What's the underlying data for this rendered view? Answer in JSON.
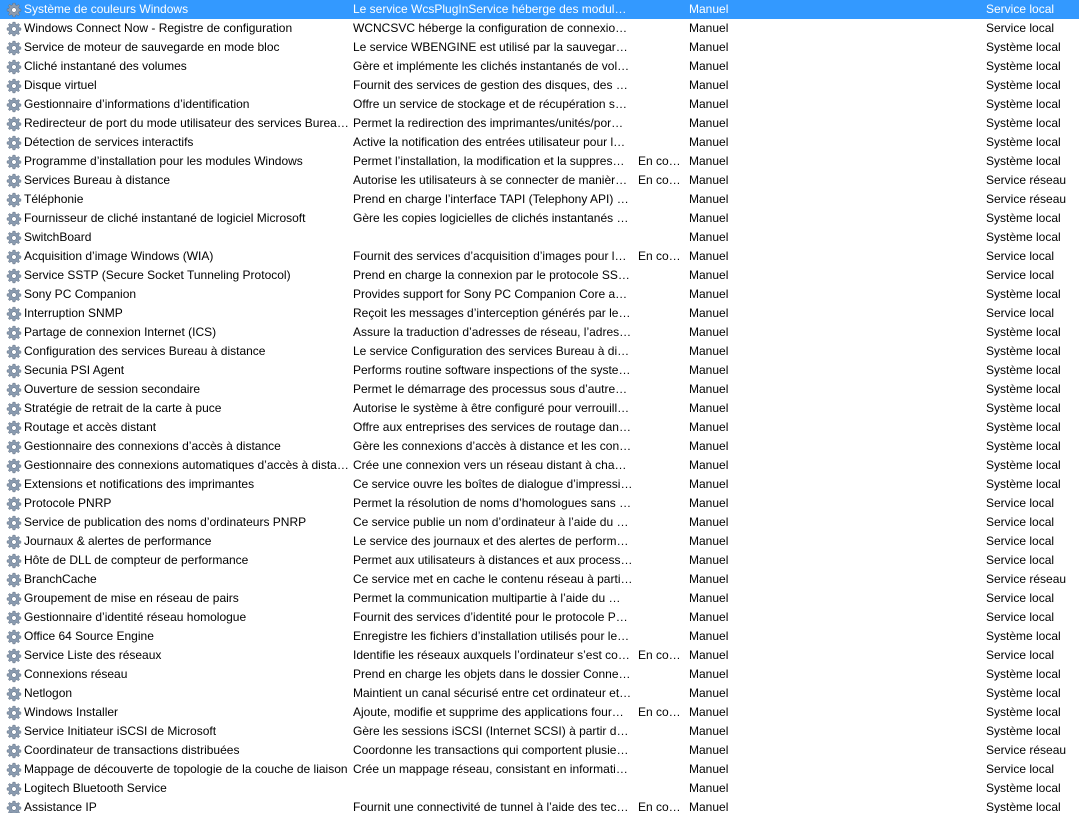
{
  "services": [
    {
      "name": "Système de couleurs Windows",
      "description": "Le service WcsPlugInService héberge des modules…",
      "status": "",
      "startup": "Manuel",
      "logon": "Service local",
      "selected": true
    },
    {
      "name": "Windows Connect Now - Registre de configuration",
      "description": "WCNCSVC héberge la configuration de connexion…",
      "status": "",
      "startup": "Manuel",
      "logon": "Service local"
    },
    {
      "name": "Service de moteur de sauvegarde en mode bloc",
      "description": "Le service WBENGINE est utilisé par la sauvegarde …",
      "status": "",
      "startup": "Manuel",
      "logon": "Système local"
    },
    {
      "name": "Cliché instantané des volumes",
      "description": "Gère et implémente les clichés instantanés de vol…",
      "status": "",
      "startup": "Manuel",
      "logon": "Système local"
    },
    {
      "name": "Disque virtuel",
      "description": "Fournit des services de gestion des disques, des v…",
      "status": "",
      "startup": "Manuel",
      "logon": "Système local"
    },
    {
      "name": "Gestionnaire d’informations d’identification",
      "description": "Offre un service de stockage et de récupération sé…",
      "status": "",
      "startup": "Manuel",
      "logon": "Système local"
    },
    {
      "name": "Redirecteur de port du mode utilisateur des services Bureau…",
      "description": "Permet la redirection des imprimantes/unités/por…",
      "status": "",
      "startup": "Manuel",
      "logon": "Système local"
    },
    {
      "name": "Détection de services interactifs",
      "description": "Active la notification des entrées utilisateur pour l…",
      "status": "",
      "startup": "Manuel",
      "logon": "Système local"
    },
    {
      "name": "Programme d’installation pour les modules Windows",
      "description": "Permet l’installation, la modification et la suppres…",
      "status": "En co…",
      "startup": "Manuel",
      "logon": "Système local"
    },
    {
      "name": "Services Bureau à distance",
      "description": "Autorise les utilisateurs à se connecter de manière…",
      "status": "En co…",
      "startup": "Manuel",
      "logon": "Service réseau"
    },
    {
      "name": "Téléphonie",
      "description": "Prend en charge l’interface TAPI (Telephony API) …",
      "status": "",
      "startup": "Manuel",
      "logon": "Service réseau"
    },
    {
      "name": "Fournisseur de cliché instantané de logiciel Microsoft",
      "description": "Gère les copies logicielles de clichés instantanés d…",
      "status": "",
      "startup": "Manuel",
      "logon": "Système local"
    },
    {
      "name": "SwitchBoard",
      "description": "",
      "status": "",
      "startup": "Manuel",
      "logon": "Système local"
    },
    {
      "name": "Acquisition d’image Windows (WIA)",
      "description": "Fournit des services d’acquisition d’images pour l…",
      "status": "En co…",
      "startup": "Manuel",
      "logon": "Service local"
    },
    {
      "name": "Service SSTP (Secure Socket Tunneling Protocol)",
      "description": "Prend en charge la connexion par le protocole SST…",
      "status": "",
      "startup": "Manuel",
      "logon": "Service local"
    },
    {
      "name": "Sony PC Companion",
      "description": "Provides support for Sony PC Companion Core an…",
      "status": "",
      "startup": "Manuel",
      "logon": "Système local"
    },
    {
      "name": "Interruption SNMP",
      "description": "Reçoit les messages d’interception générés par les…",
      "status": "",
      "startup": "Manuel",
      "logon": "Service local"
    },
    {
      "name": "Partage de connexion Internet (ICS)",
      "description": "Assure la traduction d’adresses de réseau, l’adress…",
      "status": "",
      "startup": "Manuel",
      "logon": "Système local"
    },
    {
      "name": "Configuration des services Bureau à distance",
      "description": "Le service Configuration des services Bureau à dist…",
      "status": "",
      "startup": "Manuel",
      "logon": "Système local"
    },
    {
      "name": "Secunia PSI Agent",
      "description": "Performs routine software inspections of the syste…",
      "status": "",
      "startup": "Manuel",
      "logon": "Système local"
    },
    {
      "name": "Ouverture de session secondaire",
      "description": "Permet le démarrage des processus sous d’autres i…",
      "status": "",
      "startup": "Manuel",
      "logon": "Système local"
    },
    {
      "name": "Stratégie de retrait de la carte à puce",
      "description": "Autorise le système à être configuré pour verrouill…",
      "status": "",
      "startup": "Manuel",
      "logon": "Système local"
    },
    {
      "name": "Routage et accès distant",
      "description": "Offre aux entreprises des services de routage dans …",
      "status": "",
      "startup": "Manuel",
      "logon": "Système local"
    },
    {
      "name": "Gestionnaire des connexions d’accès à distance",
      "description": "Gère les connexions d’accès à distance et les conn…",
      "status": "",
      "startup": "Manuel",
      "logon": "Système local"
    },
    {
      "name": "Gestionnaire des connexions automatiques d’accès à distan…",
      "description": "Crée une connexion vers un réseau distant à chaq…",
      "status": "",
      "startup": "Manuel",
      "logon": "Système local"
    },
    {
      "name": "Extensions et notifications des imprimantes",
      "description": "Ce service ouvre les boîtes de dialogue d’impressi…",
      "status": "",
      "startup": "Manuel",
      "logon": "Système local"
    },
    {
      "name": "Protocole PNRP",
      "description": "Permet la résolution de noms d’homologues sans …",
      "status": "",
      "startup": "Manuel",
      "logon": "Service local"
    },
    {
      "name": "Service de publication des noms d’ordinateurs PNRP",
      "description": "Ce service publie un nom d’ordinateur à l’aide du …",
      "status": "",
      "startup": "Manuel",
      "logon": "Service local"
    },
    {
      "name": "Journaux & alertes de performance",
      "description": "Le service des journaux et des alertes de performa…",
      "status": "",
      "startup": "Manuel",
      "logon": "Service local"
    },
    {
      "name": "Hôte de DLL de compteur de performance",
      "description": "Permet aux utilisateurs à distances et aux processu…",
      "status": "",
      "startup": "Manuel",
      "logon": "Service local"
    },
    {
      "name": "BranchCache",
      "description": "Ce service met en cache le contenu réseau à partir…",
      "status": "",
      "startup": "Manuel",
      "logon": "Service réseau"
    },
    {
      "name": "Groupement de mise en réseau de pairs",
      "description": "Permet la communication multipartie à l’aide du …",
      "status": "",
      "startup": "Manuel",
      "logon": "Service local"
    },
    {
      "name": "Gestionnaire d’identité réseau homologue",
      "description": "Fournit des services d’identité pour le protocole P…",
      "status": "",
      "startup": "Manuel",
      "logon": "Service local"
    },
    {
      "name": "Office 64 Source Engine",
      "description": "Enregistre les fichiers d’installation utilisés pour le…",
      "status": "",
      "startup": "Manuel",
      "logon": "Système local"
    },
    {
      "name": "Service Liste des réseaux",
      "description": "Identifie les réseaux auxquels l’ordinateur s’est con…",
      "status": "En co…",
      "startup": "Manuel",
      "logon": "Service local"
    },
    {
      "name": "Connexions réseau",
      "description": "Prend en charge les objets dans le dossier Connexi…",
      "status": "",
      "startup": "Manuel",
      "logon": "Système local"
    },
    {
      "name": "Netlogon",
      "description": "Maintient un canal sécurisé entre cet ordinateur et…",
      "status": "",
      "startup": "Manuel",
      "logon": "Système local"
    },
    {
      "name": "Windows Installer",
      "description": "Ajoute, modifie et supprime des applications four…",
      "status": "En co…",
      "startup": "Manuel",
      "logon": "Système local"
    },
    {
      "name": "Service Initiateur iSCSI de Microsoft",
      "description": "Gère les sessions iSCSI (Internet SCSI) à partir de c…",
      "status": "",
      "startup": "Manuel",
      "logon": "Système local"
    },
    {
      "name": "Coordinateur de transactions distribuées",
      "description": "Coordonne les transactions qui comportent plusie…",
      "status": "",
      "startup": "Manuel",
      "logon": "Service réseau"
    },
    {
      "name": "Mappage de découverte de topologie de la couche de liaison",
      "description": "Crée un mappage réseau, consistant en informati…",
      "status": "",
      "startup": "Manuel",
      "logon": "Service local"
    },
    {
      "name": "Logitech Bluetooth Service",
      "description": "",
      "status": "",
      "startup": "Manuel",
      "logon": "Système local"
    },
    {
      "name": "Assistance IP",
      "description": "Fournit une connectivité de tunnel à l’aide des tec…",
      "status": "En co…",
      "startup": "Manuel",
      "logon": "Système local"
    }
  ],
  "icons": {
    "service": "gear-icon"
  },
  "colors": {
    "selection": "#3399ff",
    "gear": "#8a9bb0"
  }
}
